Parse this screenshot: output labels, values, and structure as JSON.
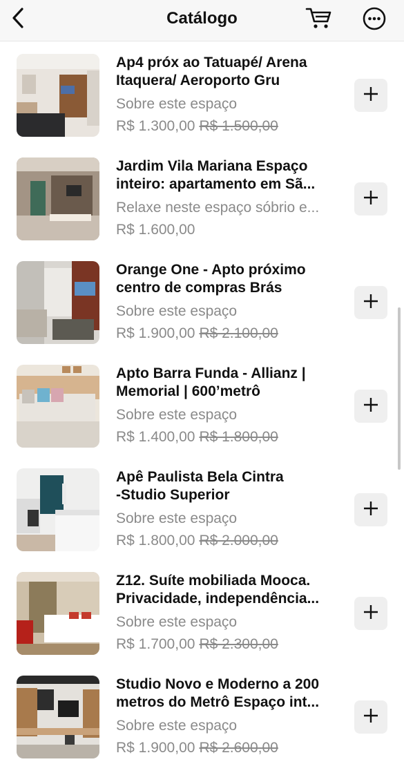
{
  "header": {
    "title": "Catálogo",
    "back_icon": "chevron-left-icon",
    "cart_icon": "cart-icon",
    "more_icon": "more-horizontal-circle-icon"
  },
  "items": [
    {
      "title_line1": "Ap4 próx ao Tatuapé/ Arena",
      "title_line2": "Itaquera/ Aeroporto Gru",
      "description": "Sobre este espaço",
      "price": "R$ 1.300,00",
      "old_price": "R$ 1.500,00",
      "add_icon": "plus-icon"
    },
    {
      "title_line1": "Jardim Vila Mariana Espaço",
      "title_line2": "inteiro: apartamento em Sã...",
      "description": "Relaxe neste espaço sóbrio e...",
      "price": "R$ 1.600,00",
      "old_price": "",
      "add_icon": "plus-icon"
    },
    {
      "title_line1": "Orange One - Apto próximo",
      "title_line2": "centro de compras Brás",
      "description": "Sobre este espaço",
      "price": "R$ 1.900,00",
      "old_price": "R$ 2.100,00",
      "add_icon": "plus-icon"
    },
    {
      "title_line1": "Apto Barra Funda - Allianz |",
      "title_line2": "Memorial | 600’metrô",
      "description": "Sobre este espaço",
      "price": "R$ 1.400,00",
      "old_price": "R$ 1.800,00",
      "add_icon": "plus-icon"
    },
    {
      "title_line1": "Apê Paulista Bela Cintra",
      "title_line2": "-Studio Superior",
      "description": "Sobre este espaço",
      "price": "R$ 1.800,00",
      "old_price": "R$ 2.000,00",
      "add_icon": "plus-icon"
    },
    {
      "title_line1": "Z12. Suíte mobiliada Mooca.",
      "title_line2": "Privacidade, independência...",
      "description": "Sobre este espaço",
      "price": "R$ 1.700,00",
      "old_price": "R$ 2.300,00",
      "add_icon": "plus-icon"
    },
    {
      "title_line1": "Studio Novo e Moderno a 200",
      "title_line2": "metros do Metrô Espaço int...",
      "description": "Sobre este espaço",
      "price": "R$ 1.900,00",
      "old_price": "R$ 2.600,00",
      "add_icon": "plus-icon"
    }
  ],
  "colors": {
    "text_primary": "#111111",
    "text_secondary": "#8a8a8a",
    "header_bg": "#f7f7f7",
    "add_button_bg": "#efefef"
  }
}
